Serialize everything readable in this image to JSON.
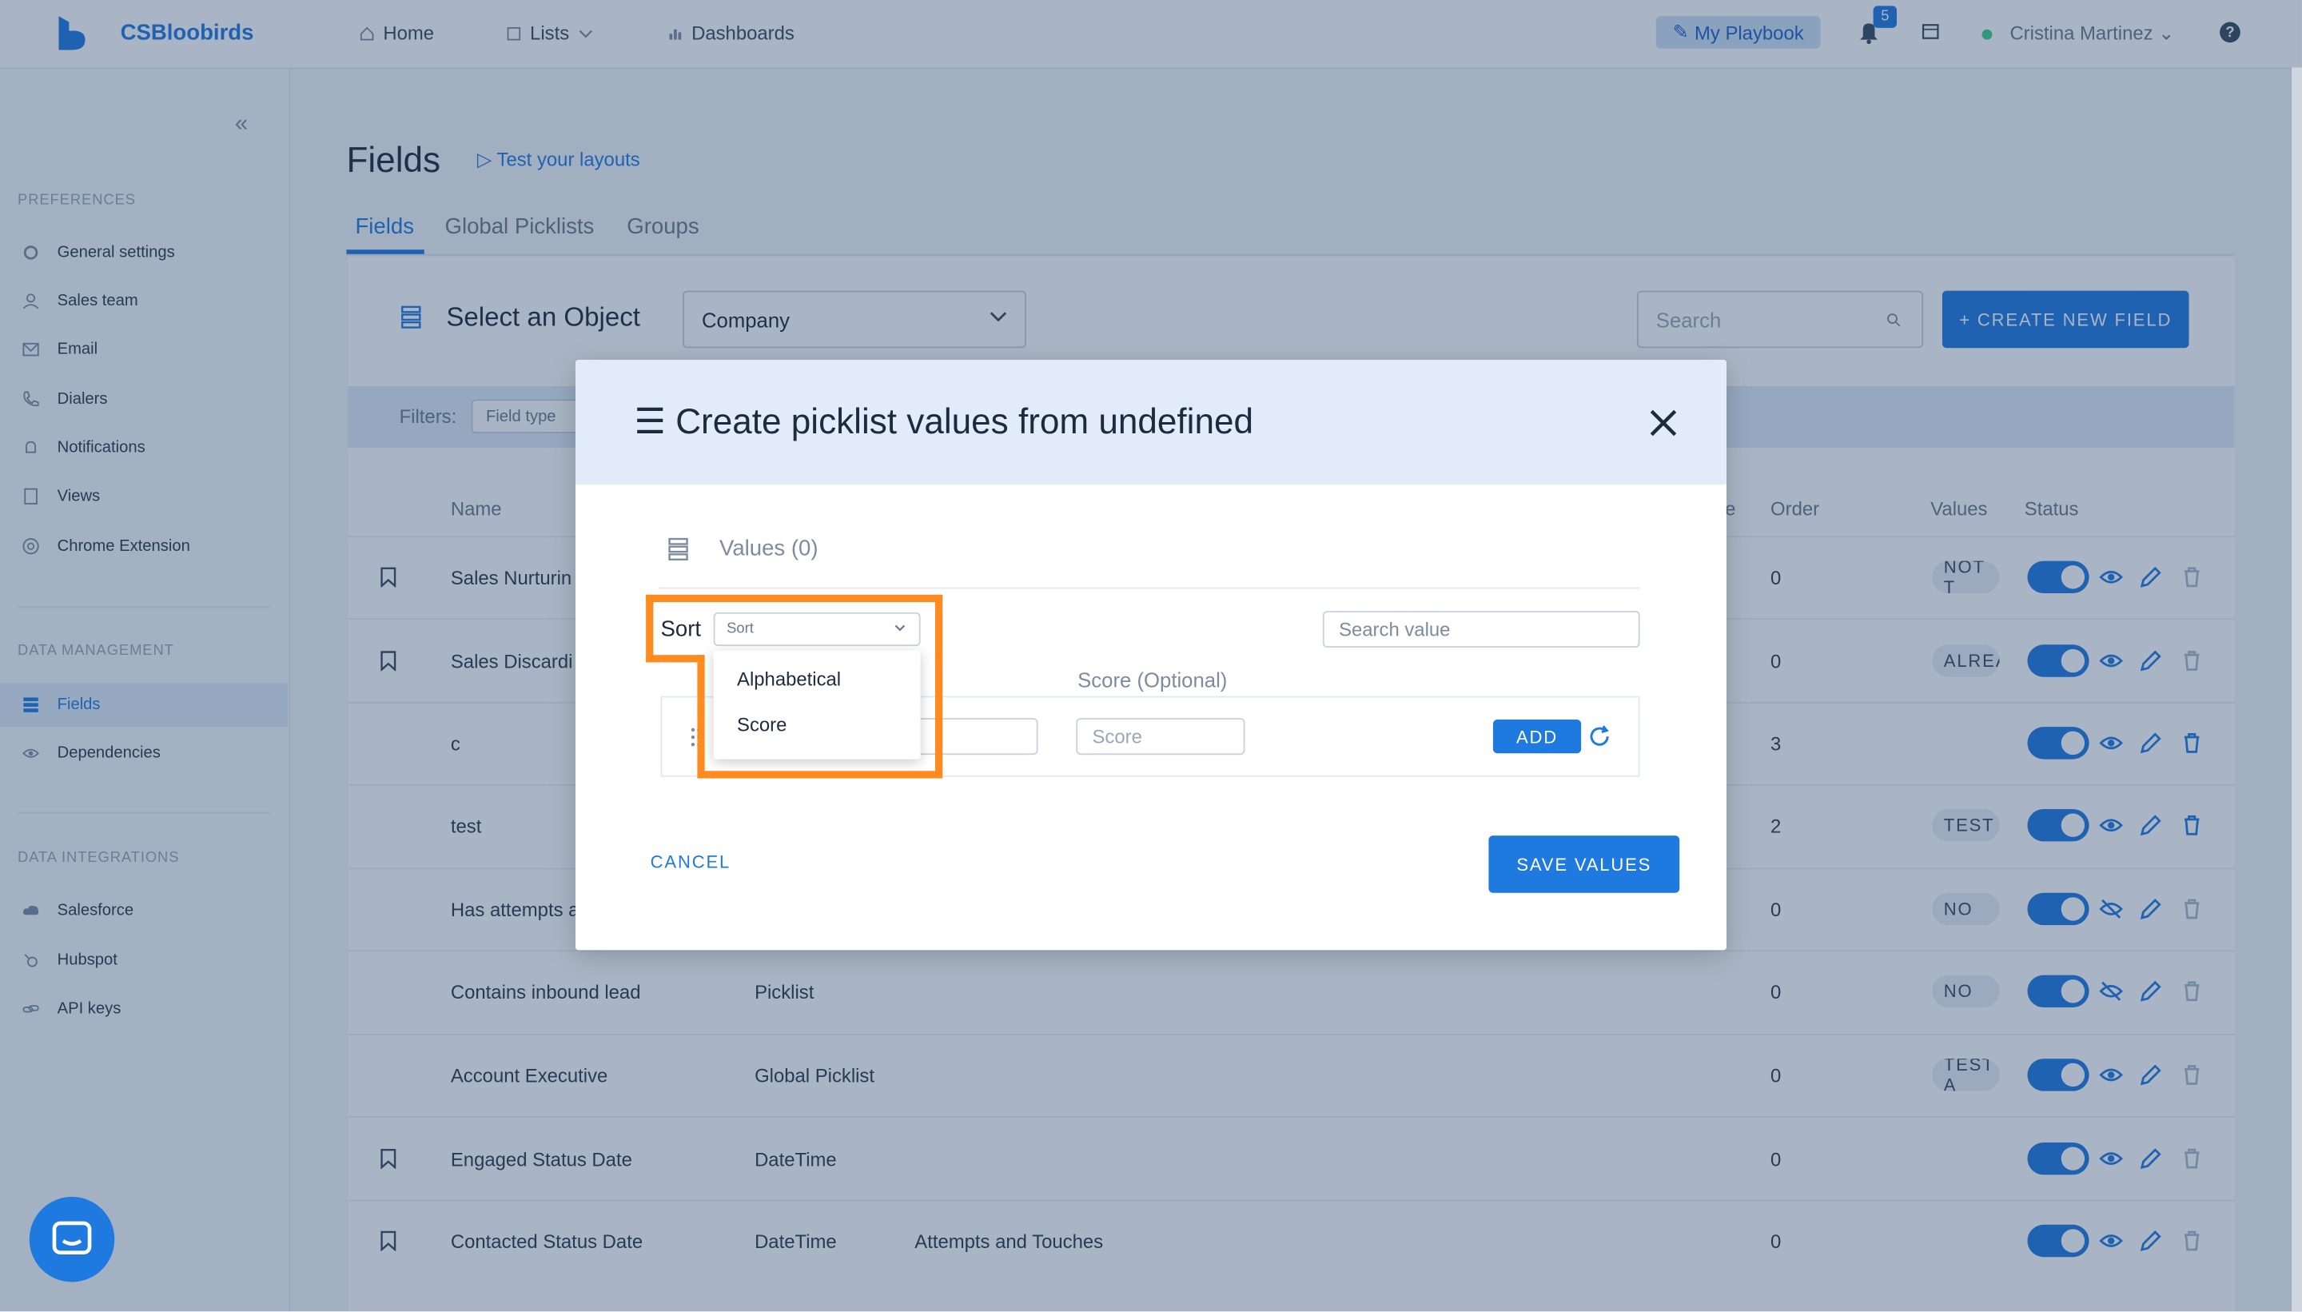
{
  "topnav": {
    "brand": "CSBloobirds",
    "home": "Home",
    "lists": "Lists",
    "dashboards": "Dashboards",
    "playbook": "My Playbook",
    "notif_count": "5",
    "user": "Cristina Martinez",
    "help": "?"
  },
  "sidebar": {
    "preferences_header": "PREFERENCES",
    "preferences": [
      "General settings",
      "Sales team",
      "Email",
      "Dialers",
      "Notifications",
      "Views",
      "Chrome Extension"
    ],
    "data_mgmt_header": "DATA MANAGEMENT",
    "data_mgmt": [
      "Fields",
      "Dependencies"
    ],
    "data_int_header": "DATA INTEGRATIONS",
    "data_int": [
      "Salesforce",
      "Hubspot",
      "API keys"
    ]
  },
  "page": {
    "title": "Fields",
    "test_link": "Test your layouts",
    "tabs": [
      "Fields",
      "Global Picklists",
      "Groups"
    ],
    "select_object_label": "Select an Object",
    "object_value": "Company",
    "search_placeholder": "Search",
    "create_button": "+ CREATE NEW FIELD",
    "filters_label": "Filters:",
    "field_type_placeholder": "Field type"
  },
  "table": {
    "headers": {
      "name": "Name",
      "order": "Order",
      "values": "Values",
      "status": "Status",
      "partial": "e"
    },
    "rows": [
      {
        "name": "Sales Nurturin",
        "type": "",
        "group": "",
        "order": "0",
        "pill": "NOT T"
      },
      {
        "name": "Sales Discardi",
        "type": "",
        "group": "",
        "order": "0",
        "pill": "ALREA"
      },
      {
        "name": "c",
        "type": "",
        "group": "",
        "order": "3",
        "pill": ""
      },
      {
        "name": "test",
        "type": "",
        "group": "",
        "order": "2",
        "pill": "TEST"
      },
      {
        "name": "Has attempts a",
        "type": "",
        "group": "",
        "order": "0",
        "pill": "NO"
      },
      {
        "name": "Contains inbound lead",
        "type": "Picklist",
        "group": "",
        "order": "0",
        "pill": "NO"
      },
      {
        "name": "Account Executive",
        "type": "Global Picklist",
        "group": "",
        "order": "0",
        "pill": "TEST A"
      },
      {
        "name": "Engaged Status Date",
        "type": "DateTime",
        "group": "",
        "order": "0",
        "pill": ""
      },
      {
        "name": "Contacted Status Date",
        "type": "DateTime",
        "group": "Attempts and Touches",
        "order": "0",
        "pill": ""
      }
    ]
  },
  "modal": {
    "title": "Create picklist values from undefined",
    "values_label": "Values (0)",
    "sort_label": "Sort",
    "sort_placeholder": "Sort",
    "search_placeholder": "Search value",
    "score_label": "Score (Optional)",
    "score_placeholder": "Score",
    "add_button": "ADD",
    "cancel_button": "CANCEL",
    "save_button": "SAVE VALUES",
    "sort_options": [
      "Alphabetical",
      "Score"
    ]
  },
  "colors": {
    "accent": "#1f7ae0",
    "highlight": "#ff8a1d"
  }
}
